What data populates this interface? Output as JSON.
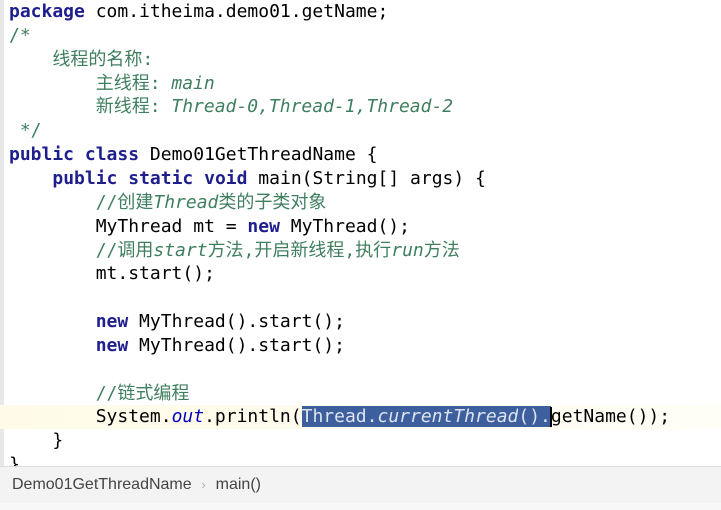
{
  "editor": {
    "lines": [
      [
        [
          "package",
          "kw"
        ],
        [
          " com.itheima.demo01.getName;",
          ""
        ]
      ],
      [
        [
          "/*",
          "cm"
        ]
      ],
      [
        [
          "    线程的名称:",
          "cm"
        ]
      ],
      [
        [
          "        主线程: ",
          "cm"
        ],
        [
          "main",
          "cmi"
        ]
      ],
      [
        [
          "        新线程: ",
          "cm"
        ],
        [
          "Thread-0,Thread-1,Thread-2",
          "cmi"
        ]
      ],
      [
        [
          " */",
          "cm"
        ]
      ],
      [
        [
          "public",
          "kw"
        ],
        [
          " ",
          ""
        ],
        [
          "class",
          "kw"
        ],
        [
          " Demo01GetThreadName {",
          ""
        ]
      ],
      [
        [
          "    ",
          ""
        ],
        [
          "public",
          "kw"
        ],
        [
          " ",
          ""
        ],
        [
          "static",
          "kw"
        ],
        [
          " ",
          ""
        ],
        [
          "void",
          "kw"
        ],
        [
          " main(String[] args) {",
          ""
        ]
      ],
      [
        [
          "        //创建",
          "cm"
        ],
        [
          "Thread",
          "cmi"
        ],
        [
          "类的子类对象",
          "cm"
        ]
      ],
      [
        [
          "        MyThread mt = ",
          ""
        ],
        [
          "new",
          "kw"
        ],
        [
          " MyThread();",
          ""
        ]
      ],
      [
        [
          "        //调用",
          "cm"
        ],
        [
          "start",
          "cmi"
        ],
        [
          "方法,开启新线程,执行",
          "cm"
        ],
        [
          "run",
          "cmi"
        ],
        [
          "方法",
          "cm"
        ]
      ],
      [
        [
          "        mt.start();",
          ""
        ]
      ],
      [],
      [
        [
          "        ",
          ""
        ],
        [
          "new",
          "kw"
        ],
        [
          " MyThread().start();",
          ""
        ]
      ],
      [
        [
          "        ",
          ""
        ],
        [
          "new",
          "kw"
        ],
        [
          " MyThread().start();",
          ""
        ]
      ],
      [],
      [
        [
          "        //链式编程",
          "cm"
        ]
      ],
      [
        [
          "        System.",
          ""
        ],
        [
          "out",
          "fld"
        ],
        [
          ".println(",
          ""
        ],
        [
          "Thread.",
          "sel"
        ],
        [
          "currentThread",
          "seli"
        ],
        [
          "().",
          "sel"
        ],
        [
          "|",
          "caret"
        ],
        [
          "getName());",
          ""
        ]
      ],
      [
        [
          "    }",
          ""
        ]
      ],
      [
        [
          "}",
          ""
        ]
      ]
    ],
    "current_line": 17
  },
  "breadcrumb": {
    "items": [
      "Demo01GetThreadName",
      "main()"
    ],
    "separator": "›"
  }
}
